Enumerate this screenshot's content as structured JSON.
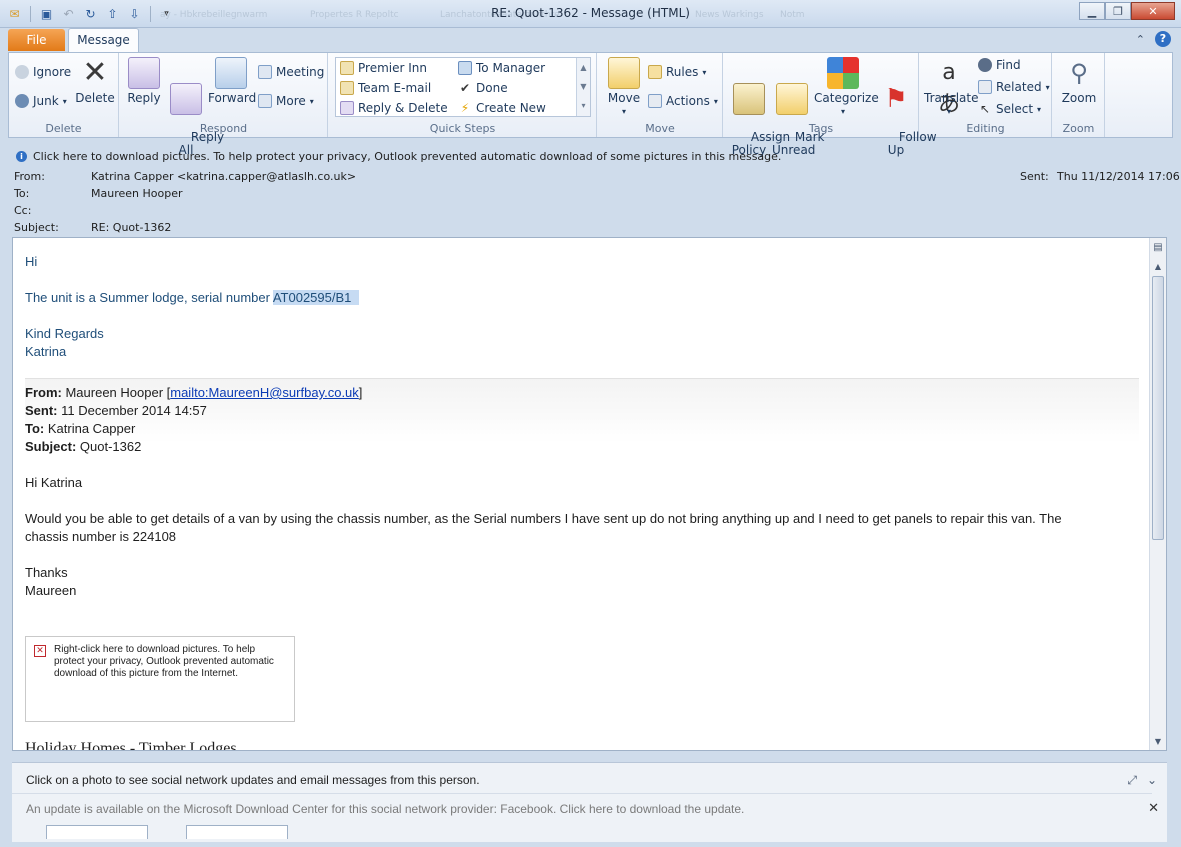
{
  "window": {
    "title": "RE: Quot-1362  -  Message (HTML)",
    "ghost_tabs": [
      "ay - Hbkrebeillegnwarm",
      "Propertes R Repoltc",
      "Lanchatonteaaatelfinnthre",
      "News Warkings",
      "Notm"
    ]
  },
  "tabs": {
    "file": "File",
    "message": "Message"
  },
  "ribbon": {
    "delete_group": {
      "label": "Delete",
      "ignore": "Ignore",
      "junk": "Junk",
      "delete": "Delete"
    },
    "respond_group": {
      "label": "Respond",
      "reply": "Reply",
      "reply_all": "Reply\nAll",
      "forward": "Forward",
      "meeting": "Meeting",
      "more": "More"
    },
    "quick_steps_group": {
      "label": "Quick Steps",
      "items": [
        "Premier Inn",
        "To Manager",
        "Team E-mail",
        "Done",
        "Reply & Delete",
        "Create New"
      ]
    },
    "move_group": {
      "label": "Move",
      "move": "Move",
      "rules": "Rules",
      "actions": "Actions"
    },
    "tags_group": {
      "label": "Tags",
      "assign_policy": "Assign\nPolicy",
      "mark_unread": "Mark\nUnread",
      "categorize": "Categorize",
      "follow_up": "Follow\nUp"
    },
    "editing_group": {
      "label": "Editing",
      "translate": "Translate",
      "find": "Find",
      "related": "Related",
      "select": "Select"
    },
    "zoom_group": {
      "label": "Zoom",
      "zoom": "Zoom"
    }
  },
  "infobar": {
    "text": "Click here to download pictures. To help protect your privacy, Outlook prevented automatic download of some pictures in this message."
  },
  "header": {
    "from_label": "From:",
    "from_value": "Katrina Capper <katrina.capper@atlaslh.co.uk>",
    "to_label": "To:",
    "to_value": "Maureen Hooper",
    "cc_label": "Cc:",
    "cc_value": "",
    "subject_label": "Subject:",
    "subject_value": "RE: Quot-1362",
    "sent_label": "Sent:",
    "sent_value": "Thu 11/12/2014 17:06"
  },
  "body": {
    "greeting": "Hi",
    "line1_prefix": "The unit is a Summer lodge, serial number ",
    "line1_serial": "AT002595/B1",
    "regards": "Kind Regards",
    "name": "Katrina",
    "quoted": {
      "from_label": "From:",
      "from_name": "Maureen Hooper [",
      "from_link": "mailto:MaureenH@surfbay.co.uk",
      "from_close": "]",
      "sent_label": "Sent:",
      "sent_value": "11 December 2014 14:57",
      "to_label": "To:",
      "to_value": "Katrina Capper",
      "subject_label": "Subject:",
      "subject_value": "Quot-1362",
      "greeting": "Hi Katrina",
      "paragraph_line1": "Would you be able to get details of a van by using the chassis number, as the Serial numbers I have sent up do not bring anything up and I need to get panels to repair this van.  The",
      "paragraph_line2": "chassis number is 224108",
      "thanks": "Thanks",
      "signoff": "Maureen",
      "image_placeholder": "Right-click here to download pictures.  To help protect your privacy, Outlook prevented automatic download of this picture from the Internet.",
      "footer_cut": "Holiday Homes - Timber Lodges"
    }
  },
  "people_pane": {
    "line1": "Click on a photo to see social network updates and email messages from this person.",
    "line2": "An update is available on the Microsoft Download Center for this social network provider: Facebook. Click here to download the update."
  }
}
